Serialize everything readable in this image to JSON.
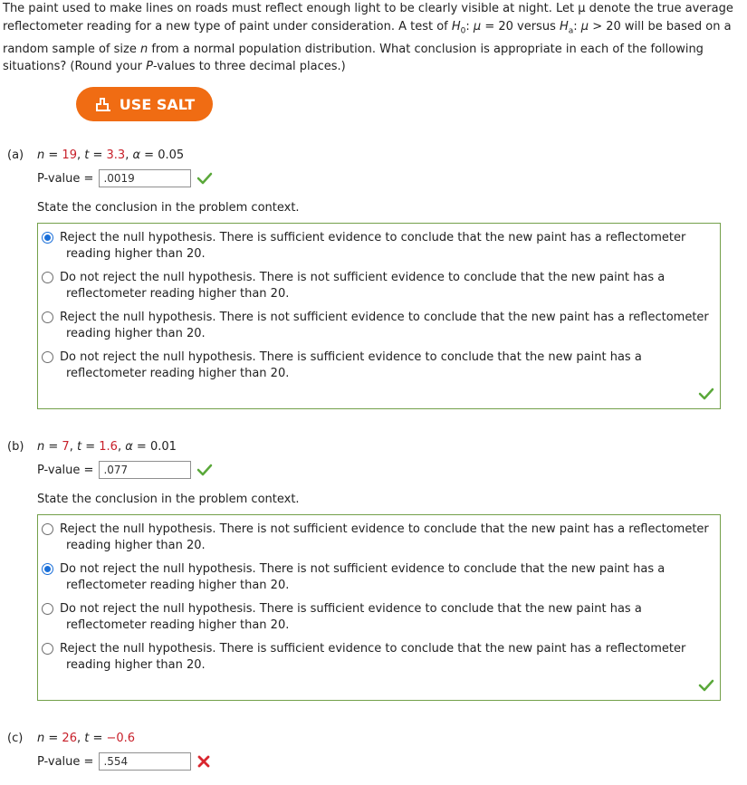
{
  "intro": {
    "line1": "The paint used to make lines on roads must reflect enough light to be clearly visible at night. Let μ denote the true average",
    "line2": "reflectometer reading for a new type of paint under consideration. A test of H0: μ = 20 versus Ha: μ > 20 will be based on a",
    "line3": "random sample of size n from a normal population distribution. What conclusion is appropriate in each of the following",
    "line4": "situations? (Round your P-values to three decimal places.)"
  },
  "salt_button": {
    "label": "USE SALT"
  },
  "pvalue_label": "P-value =",
  "state_label": "State the conclusion in the problem context.",
  "parts": [
    {
      "label": "(a)",
      "n": "19",
      "t": "3.3",
      "alpha": "0.05",
      "pvalue": ".0019",
      "pvalue_status": "correct",
      "options": [
        {
          "line1": "Reject the null hypothesis. There is sufficient evidence to conclude that the new paint has a reflectometer",
          "line2": "reading higher than 20.",
          "selected": true
        },
        {
          "line1": "Do not reject the null hypothesis. There is not sufficient evidence to conclude that the new paint has a",
          "line2": "reflectometer reading higher than 20.",
          "selected": false
        },
        {
          "line1": "Reject the null hypothesis. There is not sufficient evidence to conclude that the new paint has a reflectometer",
          "line2": "reading higher than 20.",
          "selected": false
        },
        {
          "line1": "Do not reject the null hypothesis. There is sufficient evidence to conclude that the new paint has a",
          "line2": "reflectometer reading higher than 20.",
          "selected": false
        }
      ],
      "box_status": "correct"
    },
    {
      "label": "(b)",
      "n": "7",
      "t": "1.6",
      "alpha": "0.01",
      "pvalue": ".077",
      "pvalue_status": "correct",
      "options": [
        {
          "line1": "Reject the null hypothesis. There is not sufficient evidence to conclude that the new paint has a reflectometer",
          "line2": "reading higher than 20.",
          "selected": false
        },
        {
          "line1": "Do not reject the null hypothesis. There is not sufficient evidence to conclude that the new paint has a",
          "line2": "reflectometer reading higher than 20.",
          "selected": true
        },
        {
          "line1": "Do not reject the null hypothesis. There is sufficient evidence to conclude that the new paint has a",
          "line2": "reflectometer reading higher than 20.",
          "selected": false
        },
        {
          "line1": "Reject the null hypothesis. There is sufficient evidence to conclude that the new paint has a reflectometer",
          "line2": "reading higher than 20.",
          "selected": false
        }
      ],
      "box_status": "correct"
    },
    {
      "label": "(c)",
      "n": "26",
      "t": "−0.6",
      "pvalue": ".554",
      "pvalue_status": "incorrect"
    }
  ],
  "colors": {
    "accent": "#f06c13",
    "correct": "#5aa83a",
    "incorrect": "#d9262e",
    "highlight_param": "#c8202a",
    "radio_selected": "#1a6fd9"
  }
}
